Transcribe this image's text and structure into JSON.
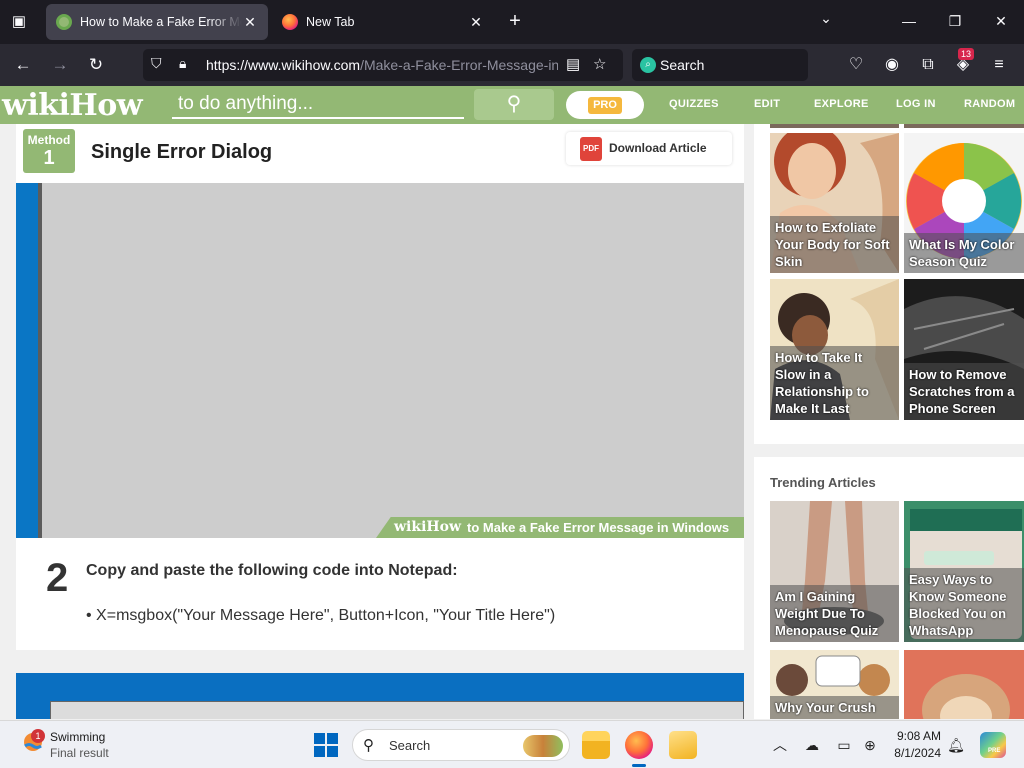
{
  "browser": {
    "tabs": [
      {
        "title": "How to Make a Fake Error Message in Windows",
        "active": true
      },
      {
        "title": "New Tab",
        "active": false
      }
    ],
    "url_host": "https://www.wikihow.com",
    "url_path": "/Make-a-Fake-Error-Message-in-Windows",
    "search_placeholder": "Search",
    "extension_badge": "13"
  },
  "wikihow": {
    "logo_wiki": "wiki",
    "logo_how": "How",
    "search_text": "to do anything...",
    "pro_label": "PRO",
    "nav": [
      "QUIZZES",
      "EDIT",
      "EXPLORE",
      "LOG IN",
      "RANDOM"
    ]
  },
  "article": {
    "method_label": "Method",
    "method_number": "1",
    "method_title": "Single Error Dialog",
    "download_label": "Download Article",
    "pdf_label": "PDF",
    "watermark_logo_wiki": "wiki",
    "watermark_logo_how": "How",
    "watermark_text": "to Make a Fake Error Message in Windows",
    "step_number": "2",
    "step_text": "Copy and paste the following code into Notepad:",
    "code_bullet": "X=msgbox(\"Your Message Here\", Button+Icon, \"Your Title Here\")"
  },
  "sidebar": {
    "related": [
      {
        "title": "How to Exfoliate Your Body for Soft Skin",
        "color": "#e7c9a6"
      },
      {
        "title": "What Is My Color Season Quiz",
        "color": "#ffffff"
      },
      {
        "title": "How to Take It Slow in a Relationship to Make It Last",
        "color": "#efe2c4"
      },
      {
        "title": "How to Remove Scratches from a Phone Screen",
        "color": "#3a3a3a"
      }
    ],
    "trending_title": "Trending Articles",
    "trending": [
      {
        "title": "Am I Gaining Weight Due To Menopause Quiz",
        "color": "#d9d1c9"
      },
      {
        "title": "Easy Ways to Know Someone Blocked You on WhatsApp",
        "color": "#3c8f6a"
      },
      {
        "title": "Why Your Crush",
        "color": "#f1e7cf"
      },
      {
        "title": "",
        "color": "#e0735a"
      }
    ]
  },
  "taskbar": {
    "weather_badge": "1",
    "weather_title": "Swimming",
    "weather_sub": "Final result",
    "search_text": "Search",
    "time": "9:08 AM",
    "date": "8/1/2024",
    "copilot_badge": "PRE"
  },
  "colors": {
    "wikihow_green": "#93b874",
    "browser_dark": "#1c1b22",
    "toolbar": "#2b2a33",
    "windows_blue": "#0067c0"
  }
}
